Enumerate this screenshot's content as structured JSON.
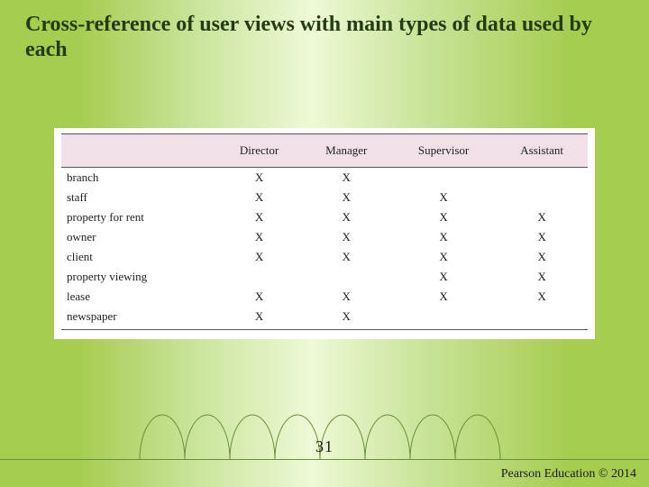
{
  "title": "Cross-reference of user views with main types of data used by each",
  "page_number": "31",
  "copyright": "Pearson Education © 2014",
  "chart_data": {
    "type": "table",
    "title": "Cross-reference of user views with main types of data used by each",
    "columns": [
      "Director",
      "Manager",
      "Supervisor",
      "Assistant"
    ],
    "rows": [
      {
        "label": "branch",
        "cells": [
          "X",
          "X",
          "",
          ""
        ]
      },
      {
        "label": "staff",
        "cells": [
          "X",
          "X",
          "X",
          ""
        ]
      },
      {
        "label": "property for rent",
        "cells": [
          "X",
          "X",
          "X",
          "X"
        ]
      },
      {
        "label": "owner",
        "cells": [
          "X",
          "X",
          "X",
          "X"
        ]
      },
      {
        "label": "client",
        "cells": [
          "X",
          "X",
          "X",
          "X"
        ]
      },
      {
        "label": "property viewing",
        "cells": [
          "",
          "",
          "X",
          "X"
        ]
      },
      {
        "label": "lease",
        "cells": [
          "X",
          "X",
          "X",
          "X"
        ]
      },
      {
        "label": "newspaper",
        "cells": [
          "X",
          "X",
          "",
          ""
        ]
      }
    ]
  }
}
